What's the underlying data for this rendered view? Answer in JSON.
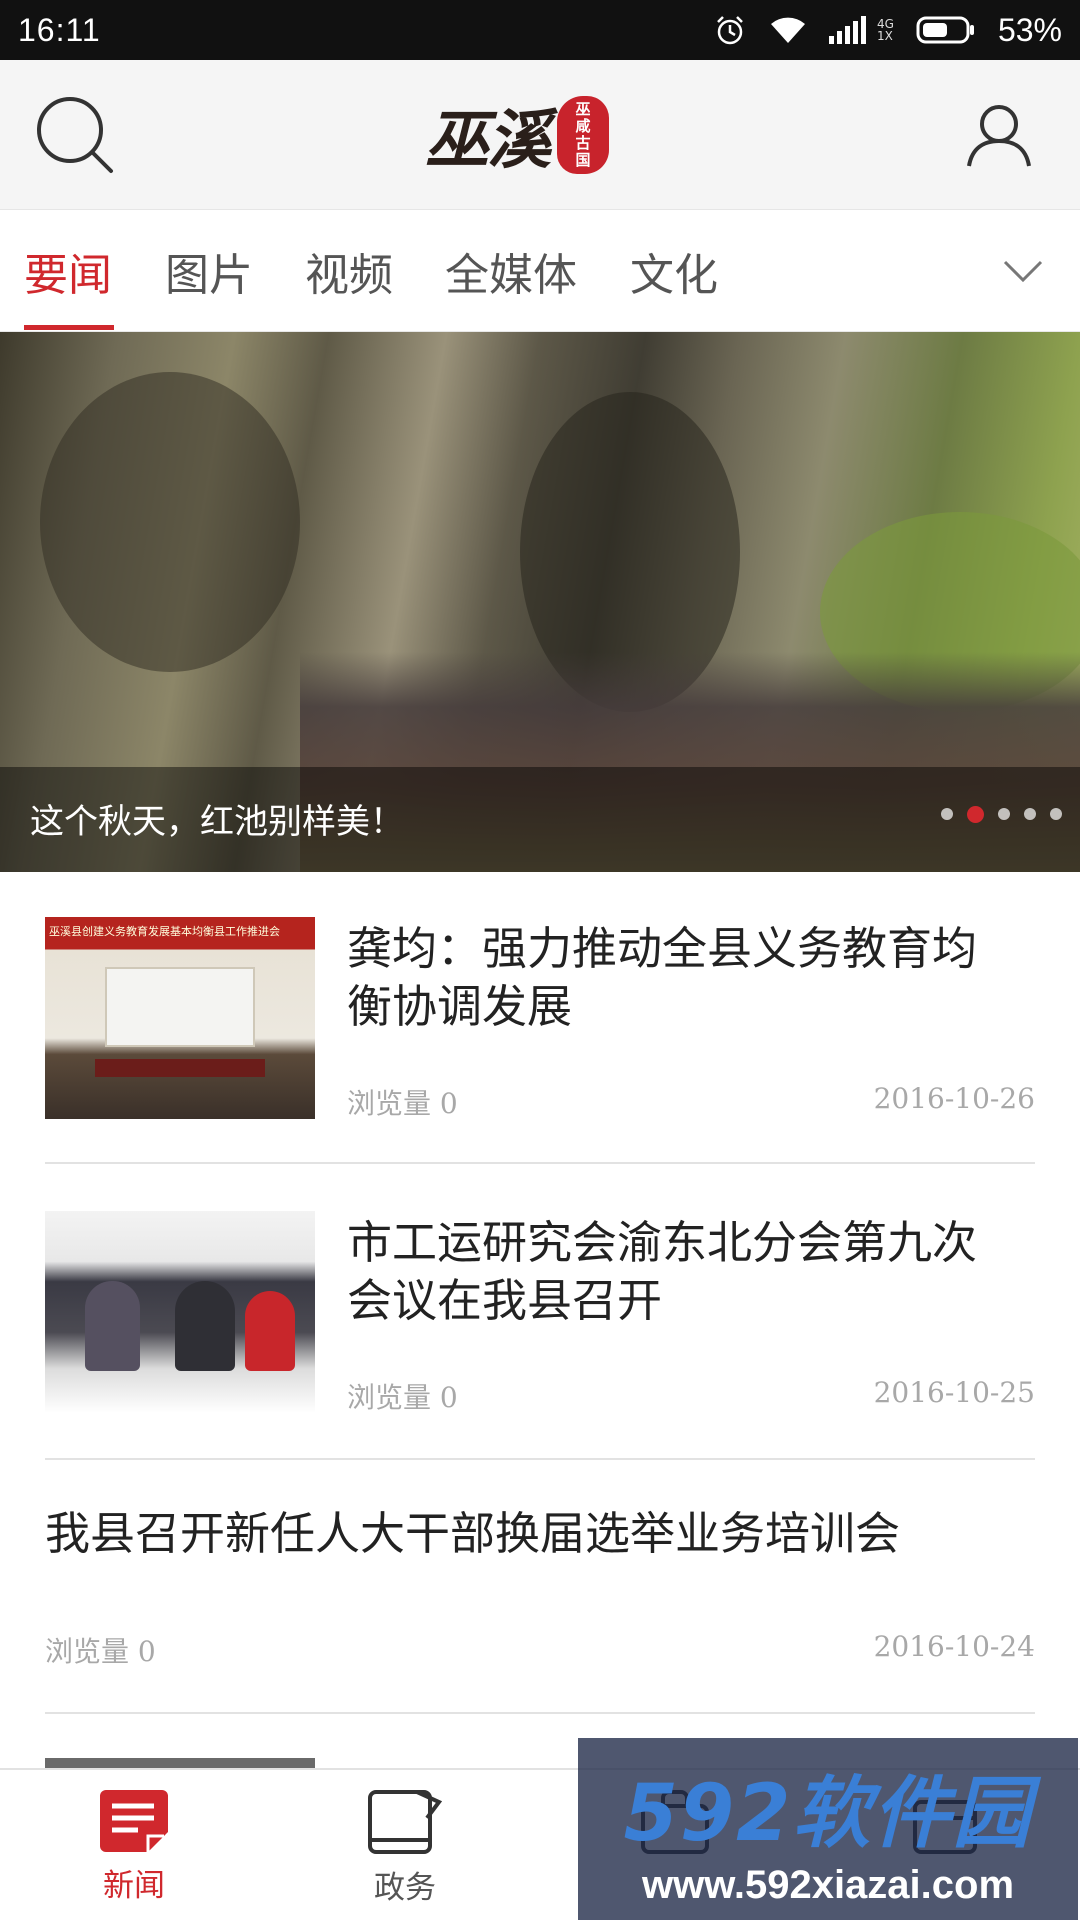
{
  "status_bar": {
    "time": "16:11",
    "network": [
      "4G",
      "1X"
    ],
    "battery_percent": "53%"
  },
  "header": {
    "logo_text": "巫溪",
    "logo_seal": [
      "巫",
      "咸",
      "古",
      "国"
    ]
  },
  "tabs": [
    {
      "label": "要闻",
      "active": true
    },
    {
      "label": "图片",
      "active": false
    },
    {
      "label": "视频",
      "active": false
    },
    {
      "label": "全媒体",
      "active": false
    },
    {
      "label": "文化",
      "active": false
    }
  ],
  "banner": {
    "caption": "这个秋天，红池别样美！",
    "slide_count": 5,
    "active_slide": 2
  },
  "news": [
    {
      "title": "龚均：强力推动全县义务教育均衡协调发展",
      "title_lines": [
        "龚均：强力推动全县义务教育均",
        "衡协调发展"
      ],
      "views_label": "浏览量 0",
      "date": "2016-10-26",
      "has_image": true,
      "image_banner_text": "巫溪县创建义务教育发展基本均衡县工作推进会"
    },
    {
      "title": "市工运研究会渝东北分会第九次会议在我县召开",
      "title_lines": [
        "市工运研究会渝东北分会第九次",
        "会议在我县召开"
      ],
      "views_label": "浏览量 0",
      "date": "2016-10-25",
      "has_image": true
    },
    {
      "title": "我县召开新任人大干部换届选举业务培训会",
      "views_label": "浏览量 0",
      "date": "2016-10-24",
      "has_image": false
    }
  ],
  "bottom_nav": [
    {
      "label": "新闻",
      "icon": "news-icon",
      "active": true
    },
    {
      "label": "政务",
      "icon": "government-icon",
      "active": false
    },
    {
      "label": "",
      "icon": "bag-icon",
      "active": false
    },
    {
      "label": "",
      "icon": "box-icon",
      "active": false
    }
  ],
  "watermark": {
    "top": "592软件园",
    "bottom": "www.592xiazai.com"
  },
  "colors": {
    "accent": "#d0282d",
    "status_bar": "#111111",
    "header_bg": "#f5f5f5",
    "meta_text": "#a8a8a8"
  }
}
